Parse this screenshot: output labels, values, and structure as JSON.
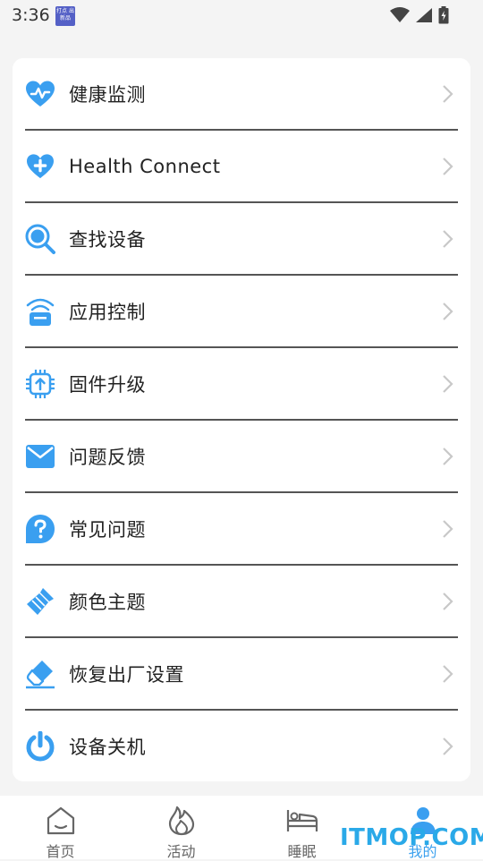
{
  "status": {
    "time": "3:36",
    "app_icon_text": "打点 出新品"
  },
  "colors": {
    "accent": "#3aa0ee",
    "icon_blue": "#3a9ff0",
    "chevron": "#c8c8c8",
    "divider": "#555555"
  },
  "menu": {
    "items": [
      {
        "label": "健康监测",
        "icon": "heart-pulse-icon"
      },
      {
        "label": "Health Connect",
        "icon": "heart-plus-icon"
      },
      {
        "label": "查找设备",
        "icon": "search-icon"
      },
      {
        "label": "应用控制",
        "icon": "wifi-box-icon"
      },
      {
        "label": "固件升级",
        "icon": "chip-upload-icon"
      },
      {
        "label": "问题反馈",
        "icon": "mail-icon"
      },
      {
        "label": "常见问题",
        "icon": "question-bubble-icon"
      },
      {
        "label": "颜色主题",
        "icon": "paint-brush-icon"
      },
      {
        "label": "恢复出厂设置",
        "icon": "eraser-icon"
      },
      {
        "label": "设备关机",
        "icon": "power-icon"
      }
    ]
  },
  "nav": {
    "items": [
      {
        "label": "首页",
        "icon": "home-icon"
      },
      {
        "label": "活动",
        "icon": "flame-icon"
      },
      {
        "label": "睡眠",
        "icon": "bed-icon"
      },
      {
        "label": "我的",
        "icon": "person-icon"
      }
    ],
    "active_index": 3
  },
  "watermark": "ITMOP.COM"
}
